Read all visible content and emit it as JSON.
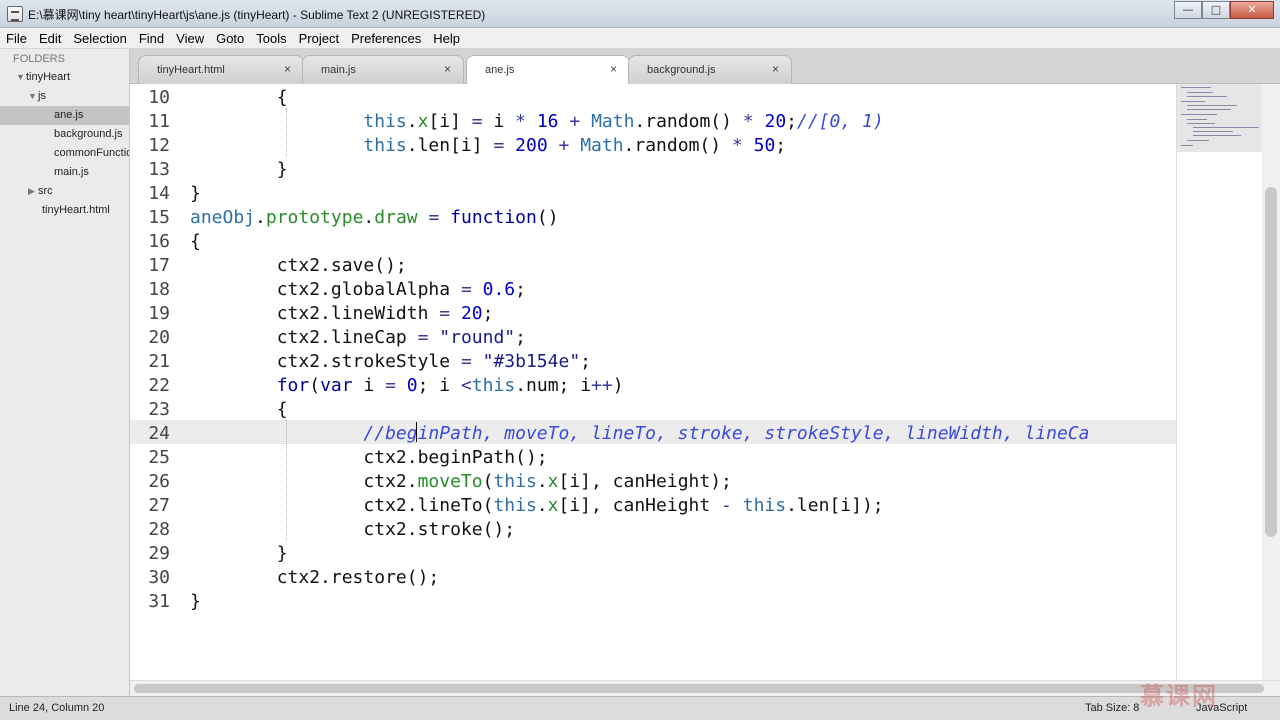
{
  "window": {
    "title": "E:\\慕课网\\tiny heart\\tinyHeart\\js\\ane.js (tinyHeart) - Sublime Text 2 (UNREGISTERED)"
  },
  "menu": [
    "File",
    "Edit",
    "Selection",
    "Find",
    "View",
    "Goto",
    "Tools",
    "Project",
    "Preferences",
    "Help"
  ],
  "sidebar": {
    "header": "FOLDERS",
    "items": [
      {
        "label": "tinyHeart"
      },
      {
        "label": "js"
      },
      {
        "label": "ane.js"
      },
      {
        "label": "background.js"
      },
      {
        "label": "commonFunctions.js"
      },
      {
        "label": "main.js"
      },
      {
        "label": "src"
      },
      {
        "label": "tinyHeart.html"
      }
    ]
  },
  "tabs": [
    {
      "label": "tinyHeart.html",
      "close": "×"
    },
    {
      "label": "main.js",
      "close": "×"
    },
    {
      "label": "ane.js",
      "close": "×"
    },
    {
      "label": "background.js",
      "close": "×"
    }
  ],
  "editor": {
    "line_numbers": [
      "10",
      "11",
      "12",
      "13",
      "14",
      "15",
      "16",
      "17",
      "18",
      "19",
      "20",
      "21",
      "22",
      "23",
      "24",
      "25",
      "26",
      "27",
      "28",
      "29",
      "30",
      "31"
    ],
    "current_line": 24,
    "lines": [
      "        {",
      "                this.x[i] = i * 16 + Math.random() * 20;//[0, 1)",
      "                this.len[i] = 200 + Math.random() * 50;",
      "        }",
      "}",
      "aneObj.prototype.draw = function()",
      "{",
      "        ctx2.save();",
      "        ctx2.globalAlpha = 0.6;",
      "        ctx2.lineWidth = 20;",
      "        ctx2.lineCap = \"round\";",
      "        ctx2.strokeStyle = \"#3b154e\";",
      "        for(var i = 0; i <this.num; i++)",
      "        {",
      "                //beginPath, moveTo, lineTo, stroke, strokeStyle, lineWidth, lineCa",
      "                ctx2.beginPath();",
      "                ctx2.moveTo(this.x[i], canHeight);",
      "                ctx2.lineTo(this.x[i], canHeight - this.len[i]);",
      "                ctx2.stroke();",
      "        }",
      "        ctx2.restore();",
      "}"
    ]
  },
  "status": {
    "position": "Line 24, Column 20",
    "tab_size": "Tab Size: 8",
    "syntax": "JavaScript"
  },
  "watermark": "慕课网",
  "window_buttons": {
    "minimize": "—",
    "maximize": "□",
    "close": "✕"
  }
}
